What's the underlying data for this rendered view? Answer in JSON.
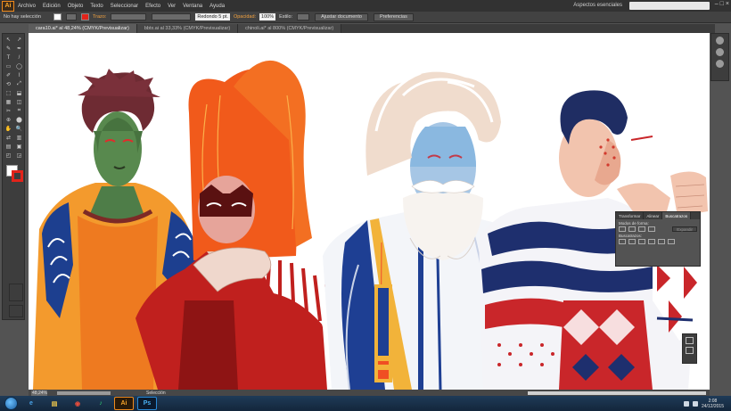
{
  "app": {
    "logo": "Ai"
  },
  "menubar": {
    "items": [
      "Archivo",
      "Edición",
      "Objeto",
      "Texto",
      "Seleccionar",
      "Efecto",
      "Ver",
      "Ventana",
      "Ayuda"
    ],
    "workspace": "Aspectos esenciales",
    "window_buttons": [
      "–",
      "□",
      "×"
    ]
  },
  "controlbar": {
    "selection_status": "No hay selección",
    "stroke_label": "Trazo:",
    "brush_label": "Redondo 5 pt.",
    "opacity_label": "Opacidad:",
    "opacity_value": "100%",
    "style_label": "Estilo:",
    "doc_setup_button": "Ajustar documento",
    "preferences_button": "Preferencias",
    "stroke_color": "#e2231a",
    "fill_color": "#ffffff"
  },
  "tabs": [
    {
      "label": "cara10.ai* al 48,24% (CMYK/Previsualizar)",
      "active": true
    },
    {
      "label": "bbtx.ai al 33,33% (CMYK/Previsualizar)",
      "active": false
    },
    {
      "label": "chinoli.ai* al 800% (CMYK/Previsualizar)",
      "active": false
    }
  ],
  "tools": [
    "↖",
    "↗",
    "✎",
    "✒",
    "T",
    "/",
    "▭",
    "◯",
    "✐",
    "⌇",
    "⟲",
    "⤢",
    "⬚",
    "⬓",
    "▦",
    "◫",
    "✂",
    "⌗",
    "⊕",
    "⬤",
    "✋",
    "🔍",
    "⇄",
    "▥",
    "▤",
    "▣",
    "◰",
    "◲"
  ],
  "float_panel": {
    "tabs": [
      "Transformar",
      "Alinear",
      "Buscatrazos"
    ],
    "active_tab": "Buscatrazos",
    "shape_modes_label": "Modos de forma:",
    "expand_button": "Expandir",
    "pathfinders_label": "Buscatrazos:"
  },
  "status": {
    "zoom": "48,24%",
    "mode": "Selección"
  },
  "taskbar": {
    "apps": [
      "e",
      "▤",
      "◉",
      "♪",
      "Ai",
      "Ps"
    ],
    "time": "2:08",
    "date": "24/12/2015"
  }
}
